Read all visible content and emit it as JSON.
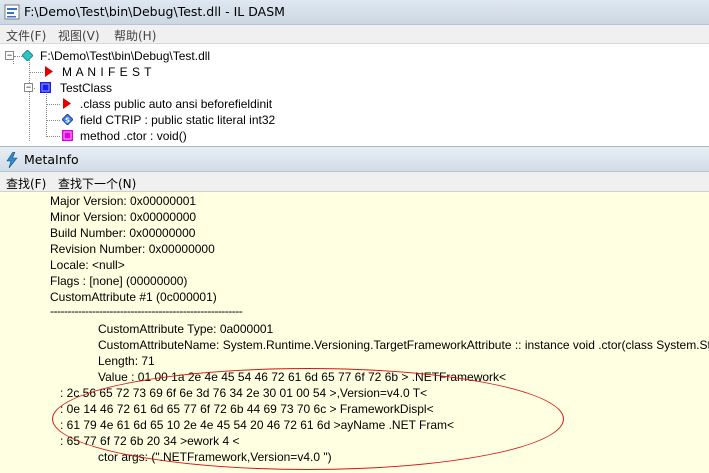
{
  "ildasm": {
    "title": "F:\\Demo\\Test\\bin\\Debug\\Test.dll - IL DASM",
    "menu": [
      "文件(F)",
      "视图(V)",
      "帮助(H)"
    ],
    "tree": {
      "root": "F:\\Demo\\Test\\bin\\Debug\\Test.dll",
      "manifest": "M A N I F E S T",
      "class": "TestClass",
      "class_children": [
        ".class public auto ansi beforefieldinit",
        "field CTRIP : public static literal int32",
        "method .ctor : void()"
      ]
    }
  },
  "metainfo": {
    "title": "MetaInfo",
    "menu": [
      "查找(F)",
      "查找下一个(N)"
    ],
    "lines": [
      "Major Version: 0x00000001",
      "Minor Version: 0x00000000",
      "Build Number: 0x00000000",
      "Revision Number: 0x00000000",
      "Locale: <null>",
      "Flags : [none] (00000000)",
      "CustomAttribute #1 (0c000001)",
      "-------------------------------------------------------",
      "CustomAttribute Type: 0a000001",
      "CustomAttributeName: System.Runtime.Versioning.TargetFrameworkAttribute :: instance void .ctor(class System.String)",
      "Length: 71",
      "Value : 01 00 1a 2e 4e 45 54 46  72 61 6d 65 77 6f 72 6b >   .NETFramework<",
      ": 2c 56 65 72 73 69 6f 6e  3d 76 34 2e 30 01 00 54 >,Version=v4.0  T<",
      ": 0e 14 46 72 61 6d 65 77  6f 72 6b 44 69 73 70 6c >  FrameworkDispl<",
      ": 61 79 4e 61 6d 65 10 2e  4e 45 54 20 46 72 61 6d >ayName .NET Fram<",
      ": 65 77 6f 72 6b 20 34                          >ework 4         <",
      "ctor args: (\".NETFramework,Version=v4.0  \")"
    ]
  },
  "colors": {
    "meta_background": "#ffffe1",
    "annotation_ellipse": "#d11111",
    "manifest_icon": "#e00000",
    "class_icon": "#1a1aff",
    "method_icon": "#e000e0"
  }
}
